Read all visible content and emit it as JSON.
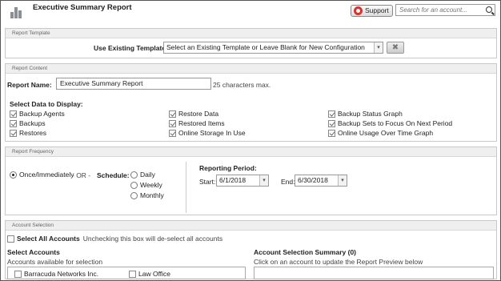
{
  "header": {
    "title": "Executive Summary Report",
    "support_label": "Support",
    "search_placeholder": "Search for an account..."
  },
  "report_template": {
    "section_title": "Report Template",
    "label": "Use Existing Template:",
    "selected": "Select an Existing Template or Leave Blank for New Configuration"
  },
  "report_content": {
    "section_title": "Report Content",
    "name_label": "Report Name:",
    "name_value": "Executive Summary Report",
    "name_hint": "25 characters max.",
    "data_label": "Select Data to Display:",
    "options": [
      {
        "label": "Backup Agents",
        "checked": true
      },
      {
        "label": "Backups",
        "checked": true
      },
      {
        "label": "Restores",
        "checked": true
      },
      {
        "label": "Restore Data",
        "checked": true
      },
      {
        "label": "Restored Items",
        "checked": true
      },
      {
        "label": "Online Storage In Use",
        "checked": true
      },
      {
        "label": "Backup Status Graph",
        "checked": true
      },
      {
        "label": "Backup Sets to Focus On Next Period",
        "checked": true
      },
      {
        "label": "Online Usage Over Time Graph",
        "checked": true
      }
    ]
  },
  "report_frequency": {
    "section_title": "Report Frequency",
    "once_label": "Once/Immediately",
    "or_text": "- OR -",
    "schedule_label": "Schedule:",
    "schedule_options": [
      "Daily",
      "Weekly",
      "Monthly"
    ],
    "period_title": "Reporting Period:",
    "start_label": "Start:",
    "start_value": "6/1/2018",
    "end_label": "End:",
    "end_value": "6/30/2018"
  },
  "account_selection": {
    "section_title": "Account Selection",
    "select_all_label": "Select All Accounts",
    "select_all_hint": "Unchecking this box will de-select all accounts",
    "select_accounts_title": "Select Accounts",
    "select_accounts_sub": "Accounts available for selection",
    "accounts": [
      "Barracuda Networks Inc.",
      "Law Office"
    ],
    "summary_title": "Account Selection Summary (0)",
    "summary_sub": "Click on an account to update the Report Preview below"
  }
}
